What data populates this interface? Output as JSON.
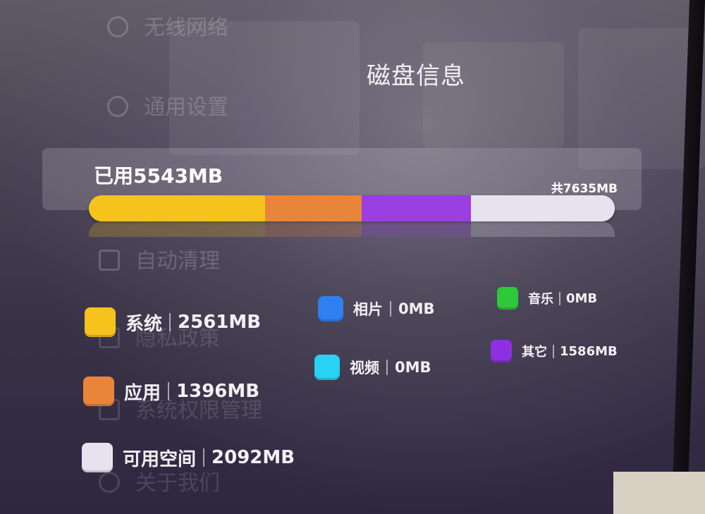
{
  "dialog": {
    "title": "磁盘信息"
  },
  "usage": {
    "used_label": "已用5543MB",
    "total_label": "共7635MB"
  },
  "bar": {
    "total_mb": 7635,
    "segments": [
      {
        "key": "system",
        "mb": 2561,
        "color": "#f6c21c"
      },
      {
        "key": "apps",
        "mb": 1396,
        "color": "#e9853a"
      },
      {
        "key": "other",
        "mb": 1586,
        "color": "#9a3ee0"
      },
      {
        "key": "free",
        "mb": 2092,
        "color": "#e6e2ee"
      }
    ]
  },
  "legend": {
    "system": {
      "name": "系统",
      "value": "2561MB",
      "color": "#f6c21c"
    },
    "apps": {
      "name": "应用",
      "value": "1396MB",
      "color": "#e9853a"
    },
    "free": {
      "name": "可用空间",
      "value": "2092MB",
      "color": "#e6e2ee"
    },
    "photos": {
      "name": "相片",
      "value": "0MB",
      "color": "#2f7ff0"
    },
    "video": {
      "name": "视频",
      "value": "0MB",
      "color": "#27d2f2"
    },
    "music": {
      "name": "音乐",
      "value": "0MB",
      "color": "#2ec93b"
    },
    "other": {
      "name": "其它",
      "value": "1586MB",
      "color": "#8e2fe0"
    }
  },
  "background_menu": {
    "items": [
      {
        "label": "无线网络",
        "icon": "wifi-icon"
      },
      {
        "label": "通用设置",
        "icon": "settings-icon"
      },
      {
        "label": "自动清理",
        "icon": "broom-icon"
      },
      {
        "label": "隐私政策",
        "icon": "privacy-icon"
      },
      {
        "label": "系统权限管理",
        "icon": "permission-icon"
      },
      {
        "label": "关于我们",
        "icon": "info-icon"
      }
    ]
  }
}
